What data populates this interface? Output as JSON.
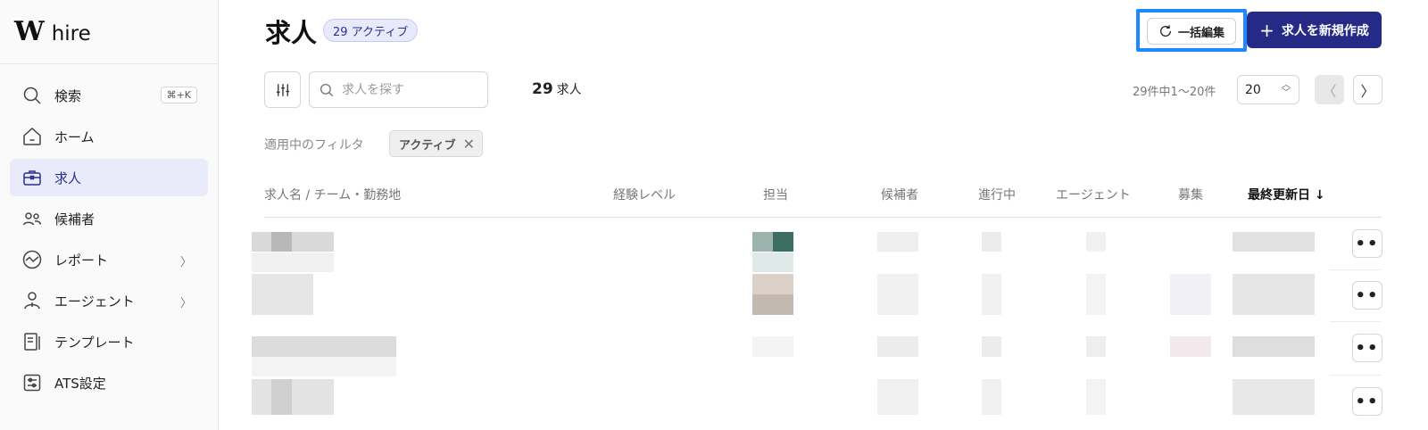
{
  "sidebar": {
    "brand_mark": "W",
    "brand_text": "hire",
    "items": [
      {
        "label": "検索",
        "icon": "search-icon",
        "shortcut": "⌘+K"
      },
      {
        "label": "ホーム",
        "icon": "home-icon"
      },
      {
        "label": "求人",
        "icon": "briefcase-icon",
        "active": true
      },
      {
        "label": "候補者",
        "icon": "people-icon"
      },
      {
        "label": "レポート",
        "icon": "chart-icon",
        "chevron": "〉"
      },
      {
        "label": "エージェント",
        "icon": "agent-icon",
        "chevron": "〉"
      },
      {
        "label": "テンプレート",
        "icon": "template-icon"
      },
      {
        "label": "ATS設定",
        "icon": "settings-icon"
      }
    ]
  },
  "header": {
    "title": "求人",
    "status_badge": "29 アクティブ",
    "bulk_edit_label": "一括編集",
    "create_label": "求人を新規作成",
    "create_icon": "plus-icon"
  },
  "toolbar": {
    "filter_icon": "sliders-icon",
    "search_placeholder": "求人を探す",
    "count_number": "29",
    "count_unit": "求人",
    "range_text": "29件中1〜20件",
    "per_page": "20",
    "prev_label": "〈",
    "next_label": "〉"
  },
  "filters": {
    "label": "適用中のフィルタ",
    "chips": [
      {
        "label": "アクティブ",
        "remove": "✕"
      }
    ]
  },
  "table": {
    "columns": [
      {
        "label": "求人名 / チーム・勤務地"
      },
      {
        "label": "経験レベル"
      },
      {
        "label": "担当"
      },
      {
        "label": "候補者"
      },
      {
        "label": "進行中"
      },
      {
        "label": "エージェント"
      },
      {
        "label": "募集"
      },
      {
        "label": "最終更新日 ↓",
        "sorted": true
      }
    ],
    "row_action_label": "••"
  },
  "colors": {
    "accent": "#262a87",
    "active_nav_bg": "#e9ebfb",
    "highlight_border": "#1e88ff"
  }
}
